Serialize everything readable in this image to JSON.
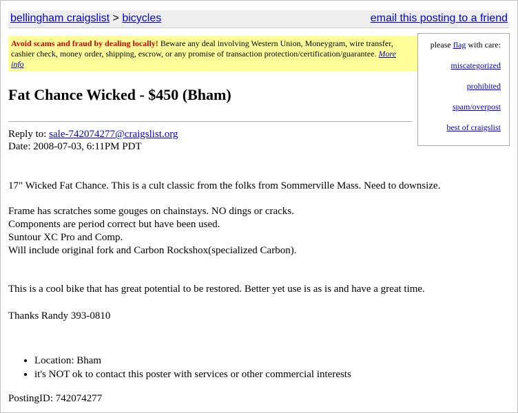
{
  "nav": {
    "city": "bellingham craigslist",
    "separator": ">",
    "category": "bicycles",
    "email_link": "email this posting to a friend"
  },
  "warning": {
    "bold": "Avoid scams and fraud by dealing locally!",
    "text": " Beware any deal involving Western Union, Moneygram, wire transfer, cashier check, money order, shipping, escrow, or any promise of transaction protection/certification/guarantee. ",
    "link": "More info"
  },
  "flag": {
    "prefix": "please ",
    "flag_link": "flag",
    "suffix": " with care:",
    "items": [
      "miscategorized",
      "prohibited",
      "spam/overpost",
      "best of craigslist"
    ]
  },
  "posting": {
    "title": "Fat Chance Wicked - $450 (Bham)",
    "reply_label": "Reply to: ",
    "reply_email": "sale-742074277@craigslist.org",
    "date": "Date: 2008-07-03, 6:11PM PDT",
    "paragraph1": "17\" Wicked Fat Chance. This is a cult classic from the folks from Sommerville Mass. Need to downsize.",
    "details": [
      "Frame has scratches some gouges on chainstays. NO dings or cracks.",
      "Components are period correct but have been used.",
      "Suntour XC Pro and Comp.",
      "Will include original fork and Carbon Rockshox(specialized Carbon)."
    ],
    "paragraph3": "This is a cool bike that has great potential to be restored. Better yet use is as is and have a great time.",
    "thanks": "Thanks Randy 393-0810",
    "bullets": [
      "Location: Bham",
      "it's NOT ok to contact this poster with services or other commercial interests"
    ],
    "posting_id": "PostingID: 742074277"
  },
  "colors": {
    "warning_bg": "#ffff99",
    "warning_bold": "#cc0000",
    "link": "#0000cc",
    "topbar_bg": "#eeeeee"
  }
}
